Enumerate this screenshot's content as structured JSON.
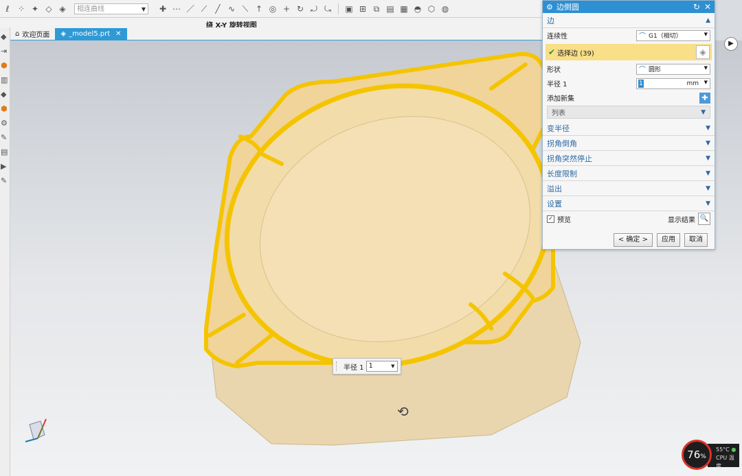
{
  "toolbar": {
    "filter_placeholder": "相连曲线",
    "icons": [
      "curve-icon",
      "point-icon",
      "arrow-icon",
      "cube-icon",
      "cube-icon",
      "snap-icon",
      "dots-icon",
      "line-icon",
      "line-icon",
      "line-icon",
      "spline-icon",
      "line-icon",
      "move-icon",
      "circle-icon",
      "plus-icon",
      "rotate-icon",
      "rotate-icon",
      "rotate-icon",
      "fit-icon",
      "view-icon",
      "view-icon",
      "view-icon",
      "view-icon",
      "shade-icon",
      "cube-icon",
      "render-icon"
    ]
  },
  "window": {
    "view_title": "绕 X-Y 旋转视图"
  },
  "tabs": [
    {
      "label": "欢迎页面",
      "icon": "home-icon"
    },
    {
      "label": "_model5.prt",
      "icon": "part-icon",
      "active": true
    }
  ],
  "dialog": {
    "title": "边倒圆",
    "section_edge": "边",
    "continuity_label": "连续性",
    "continuity_value": "G1（相切）",
    "select_edge_label": "选择边 (39)",
    "shape_label": "形状",
    "shape_value": "圆形",
    "radius_label": "半径 1",
    "radius_value": "1",
    "radius_unit": "mm",
    "add_set_label": "添加新集",
    "list_label": "列表",
    "sections": [
      "变半径",
      "拐角倒角",
      "拐角突然停止",
      "长度限制",
      "溢出",
      "设置"
    ],
    "preview_label": "预览",
    "preview_checked": true,
    "show_result_label": "显示结果",
    "ok_label": "< 确定 >",
    "apply_label": "应用",
    "cancel_label": "取消"
  },
  "floating_radius": {
    "label": "半径 1",
    "value": "1"
  },
  "cpu": {
    "percent": "76",
    "unit": "%",
    "temp": "55°C",
    "label": "CPU 温度"
  },
  "colors": {
    "accent": "#2e8fd2",
    "selection": "#f8df88",
    "model_fill": "#f0d49a",
    "fillet_edge": "#f5c400"
  }
}
